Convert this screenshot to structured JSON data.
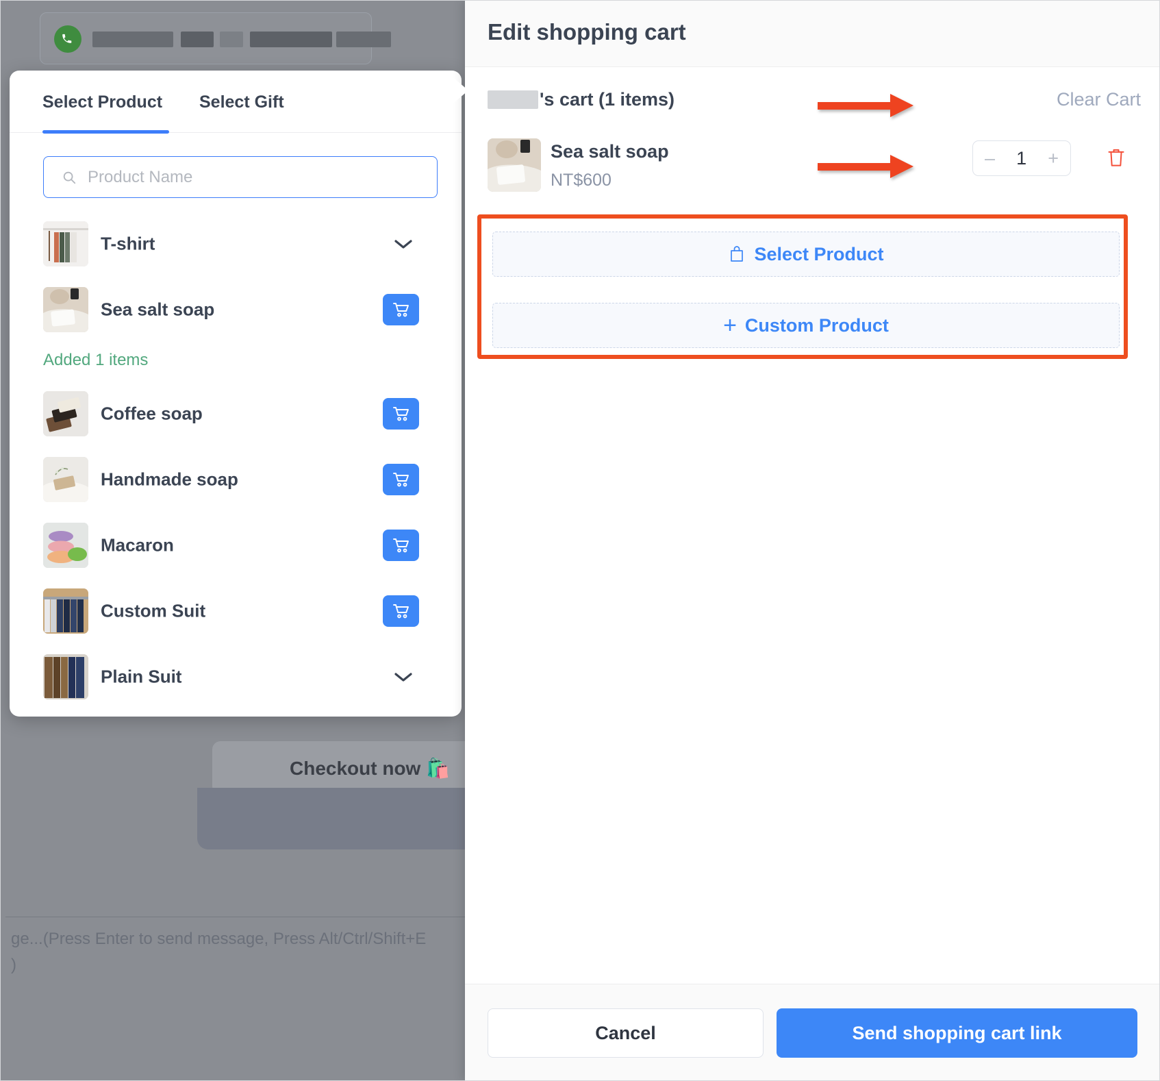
{
  "background": {
    "contact_icon": "whatsapp-phone-icon",
    "contact_name_redacted": "",
    "checkout_button_label": "Checkout now 🛍️",
    "composer_placeholder_line1": "ge...(Press Enter to send message, Press Alt/Ctrl/Shift+E",
    "composer_placeholder_line2": ")"
  },
  "product_panel": {
    "tabs": [
      {
        "label": "Select Product",
        "active": true
      },
      {
        "label": "Select Gift",
        "active": false
      }
    ],
    "search": {
      "placeholder": "Product Name",
      "value": "",
      "icon": "search-icon"
    },
    "items": [
      {
        "name": "T-shirt",
        "action": "expand",
        "note": ""
      },
      {
        "name": "Sea salt soap",
        "action": "add",
        "note": "Added 1 items"
      },
      {
        "name": "Coffee soap",
        "action": "add",
        "note": ""
      },
      {
        "name": "Handmade soap",
        "action": "add",
        "note": ""
      },
      {
        "name": "Macaron",
        "action": "add",
        "note": ""
      },
      {
        "name": "Custom Suit",
        "action": "add",
        "note": ""
      },
      {
        "name": "Plain Suit",
        "action": "expand",
        "note": ""
      }
    ]
  },
  "drawer": {
    "title": "Edit shopping cart",
    "cart_owner_suffix": "'s cart (1 items)",
    "clear_cart_label": "Clear Cart",
    "cart_items": [
      {
        "name": "Sea salt soap",
        "price": "NT$600",
        "quantity": "1",
        "decrement": "–",
        "increment": "+",
        "delete_icon": "trash-icon"
      }
    ],
    "add_actions": [
      {
        "label": "Select Product",
        "icon": "shopping-bag-icon"
      },
      {
        "label": "Custom Product",
        "icon": "plus-icon"
      }
    ],
    "footer": {
      "cancel_label": "Cancel",
      "send_label": "Send shopping cart link"
    }
  },
  "colors": {
    "accent_blue": "#3d87f7",
    "annotation_red": "#ee4320",
    "success_green": "#52a87e",
    "muted_text": "#9fa9bd",
    "title_text": "#3b4453"
  }
}
